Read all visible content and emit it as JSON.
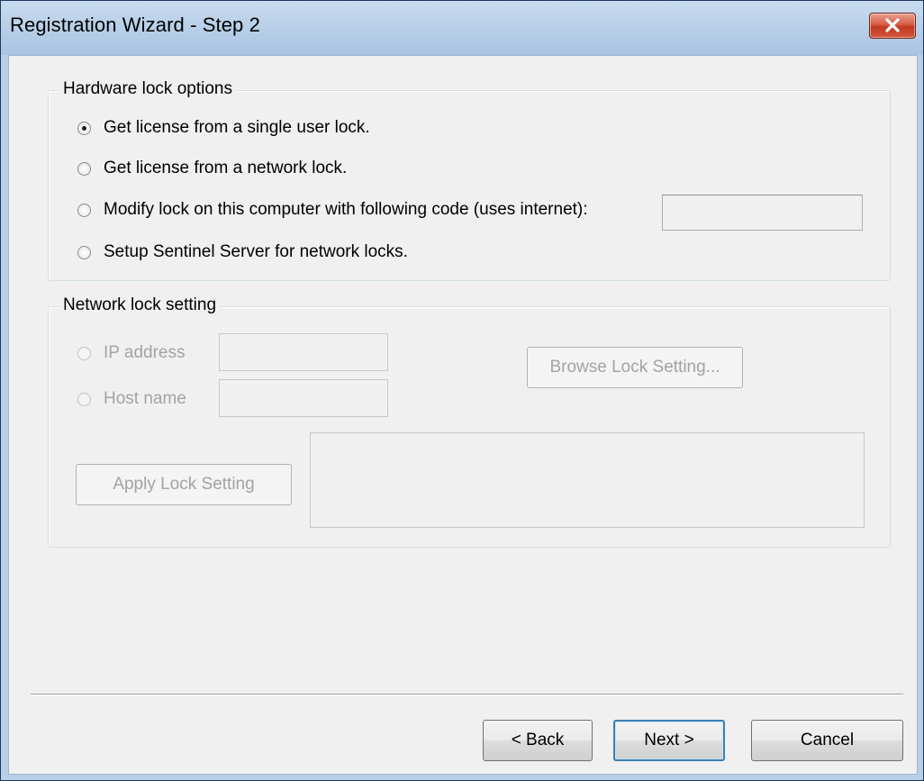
{
  "window": {
    "title": "Registration Wizard - Step 2"
  },
  "hardware_group": {
    "legend": "Hardware lock options",
    "options": [
      {
        "label": "Get license from a single user lock.",
        "checked": true
      },
      {
        "label": "Get license from a network lock.",
        "checked": false
      },
      {
        "label": "Modify lock on this computer with following code (uses internet):",
        "checked": false
      },
      {
        "label": "Setup Sentinel Server for network locks.",
        "checked": false
      }
    ],
    "code_value": ""
  },
  "network_group": {
    "legend": "Network lock setting",
    "ip_label": "IP address",
    "ip_value": "",
    "host_label": "Host name",
    "host_value": "",
    "browse_label": "Browse Lock Setting...",
    "apply_label": "Apply Lock Setting",
    "status_text": ""
  },
  "footer": {
    "back_label": "< Back",
    "next_label": "Next >",
    "cancel_label": "Cancel"
  },
  "colors": {
    "title_bar": "#b9d0e8",
    "close_button": "#d65d46",
    "dialog_bg": "#f0f0f0",
    "default_button_border": "#3c7fb1",
    "disabled_text": "#a3a3a3"
  }
}
